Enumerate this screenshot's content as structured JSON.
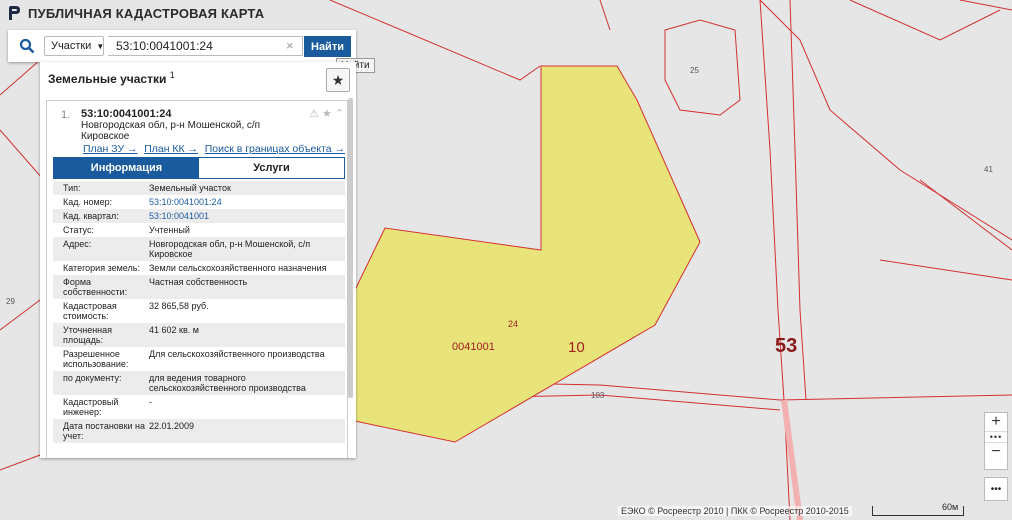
{
  "app": {
    "title": "ПУБЛИЧНАЯ КАДАСТРОВАЯ КАРТА"
  },
  "search": {
    "type_label": "Участки",
    "value": "53:10:0041001:24",
    "button_label": "Найти",
    "tooltip": "Найти"
  },
  "panel": {
    "title": "Земельные участки",
    "title_count": "1",
    "result": {
      "index": "1.",
      "cad_number": "53:10:0041001:24",
      "address_line1": "Новгородская обл, р-н Мошенской, с/п",
      "address_line2": "Кировское"
    },
    "links": [
      "План ЗУ →",
      "План КК →",
      "Поиск в границах объекта →"
    ],
    "tabs": [
      "Информация",
      "Услуги"
    ],
    "attributes": [
      {
        "key": "Тип:",
        "value": "Земельный участок",
        "link": false
      },
      {
        "key": "Кад. номер:",
        "value": "53:10:0041001:24",
        "link": true
      },
      {
        "key": "Кад. квартал:",
        "value": "53:10:0041001",
        "link": true
      },
      {
        "key": "Статус:",
        "value": "Учтенный",
        "link": false
      },
      {
        "key": "Адрес:",
        "value": "Новгородская обл, р-н Мошенской, с/п Кировское",
        "link": false
      },
      {
        "key": "Категория земель:",
        "value": "Земли сельскохозяйственного назначения",
        "link": false
      },
      {
        "key": "Форма собственности:",
        "value": "Частная собственность",
        "link": false
      },
      {
        "key": "Кадастровая стоимость:",
        "value": "32 865,58 руб.",
        "link": false
      },
      {
        "key": "Уточненная площадь:",
        "value": "41 602 кв. м",
        "link": false
      },
      {
        "key": "Разрешенное использование:",
        "value": "Для сельскохозяйственного производства",
        "link": false
      },
      {
        "key": "по документу:",
        "value": "для ведения товарного сельскохозяйственного производства",
        "link": false
      },
      {
        "key": "Кадастровый инженер:",
        "value": "-",
        "link": false
      },
      {
        "key": "Дата постановки на учет:",
        "value": "22.01.2009",
        "link": false
      }
    ]
  },
  "map": {
    "labels": {
      "quarter": "0041001",
      "parcel_num": "24",
      "ten": "10",
      "district": "53",
      "l25": "25",
      "l41": "41",
      "l29": "29",
      "l103": "103"
    },
    "attribution": "ЕЭКО © Росреестр 2010 | ПКК © Росреестр 2010-2015",
    "scale": "60м",
    "colors": {
      "parcel_fill": "#e8e47a",
      "boundary": "#d43030",
      "accent": "#1a5b9e"
    }
  }
}
